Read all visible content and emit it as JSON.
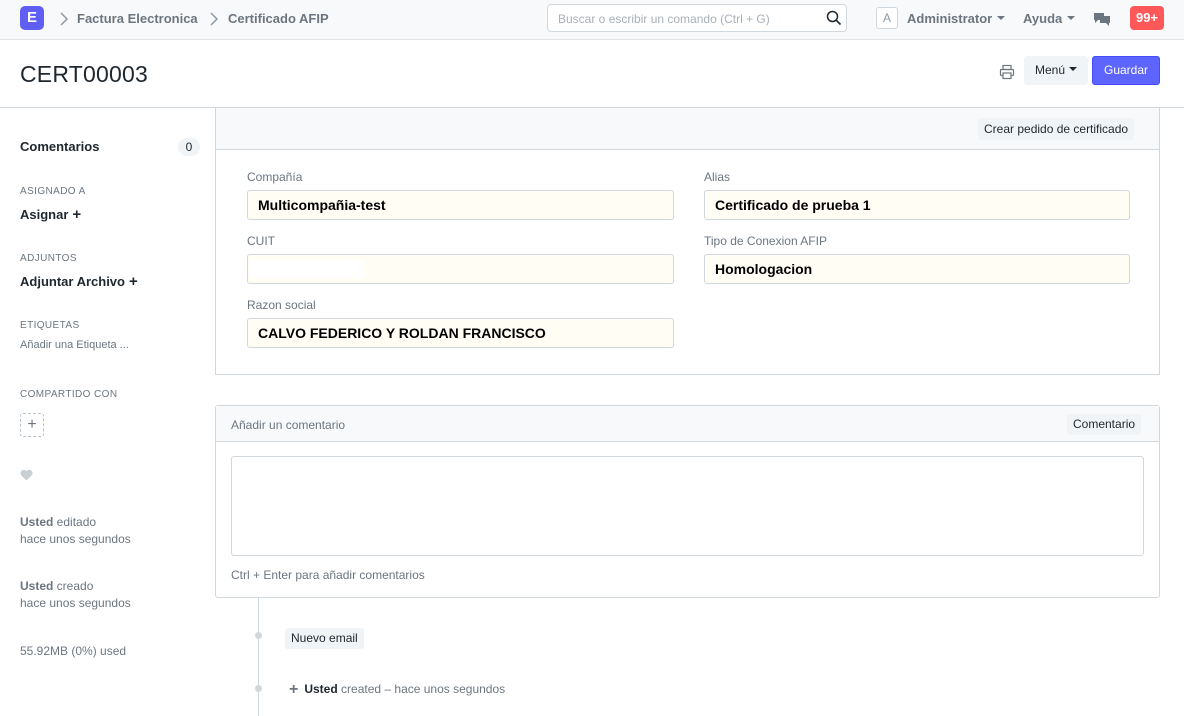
{
  "navbar": {
    "logo_letter": "E",
    "breadcrumbs": [
      "Factura Electronica",
      "Certificado AFIP"
    ],
    "search_placeholder": "Buscar o escribir un comando (Ctrl + G)",
    "avatar_letter": "A",
    "user_label": "Administrator",
    "help_label": "Ayuda",
    "notifications": "99+"
  },
  "page": {
    "title": "CERT00003",
    "menu_label": "Menú",
    "save_label": "Guardar"
  },
  "sidebar": {
    "comments_label": "Comentarios",
    "comments_count": "0",
    "assigned_heading": "ASIGNADO A",
    "assign_label": "Asignar",
    "attachments_heading": "ADJUNTOS",
    "attach_label": "Adjuntar Archivo",
    "tags_heading": "ETIQUETAS",
    "add_tag_label": "Añadir una Etiqueta ...",
    "shared_heading": "COMPARTIDO CON",
    "share_add": "+",
    "edited_user": "Usted",
    "edited_action": " editado",
    "edited_time": "hace unos segundos",
    "created_user": "Usted",
    "created_action": " creado",
    "created_time": "hace unos segundos",
    "storage": "55.92MB (0%) used"
  },
  "form": {
    "create_request_label": "Crear pedido de certificado",
    "fields": {
      "company_label": "Compañía",
      "company_value": "Multicompañia-test",
      "alias_label": "Alias",
      "alias_value": "Certificado de prueba 1",
      "cuit_label": "CUIT",
      "connection_label": "Tipo de Conexion AFIP",
      "connection_value": "Homologacion",
      "business_name_label": "Razon social",
      "business_name_value": "CALVO FEDERICO Y ROLDAN FRANCISCO"
    }
  },
  "comments": {
    "title": "Añadir un comentario",
    "button_label": "Comentario",
    "hint": "Ctrl + Enter para añadir comentarios"
  },
  "timeline": {
    "new_email_label": "Nuevo email",
    "created_plus": "+",
    "created_user": "Usted",
    "created_text": " created – hace unos segundos"
  },
  "colors": {
    "primary": "#5e64ff",
    "badge": "#ff5858",
    "input_bg": "#fffdf4"
  }
}
